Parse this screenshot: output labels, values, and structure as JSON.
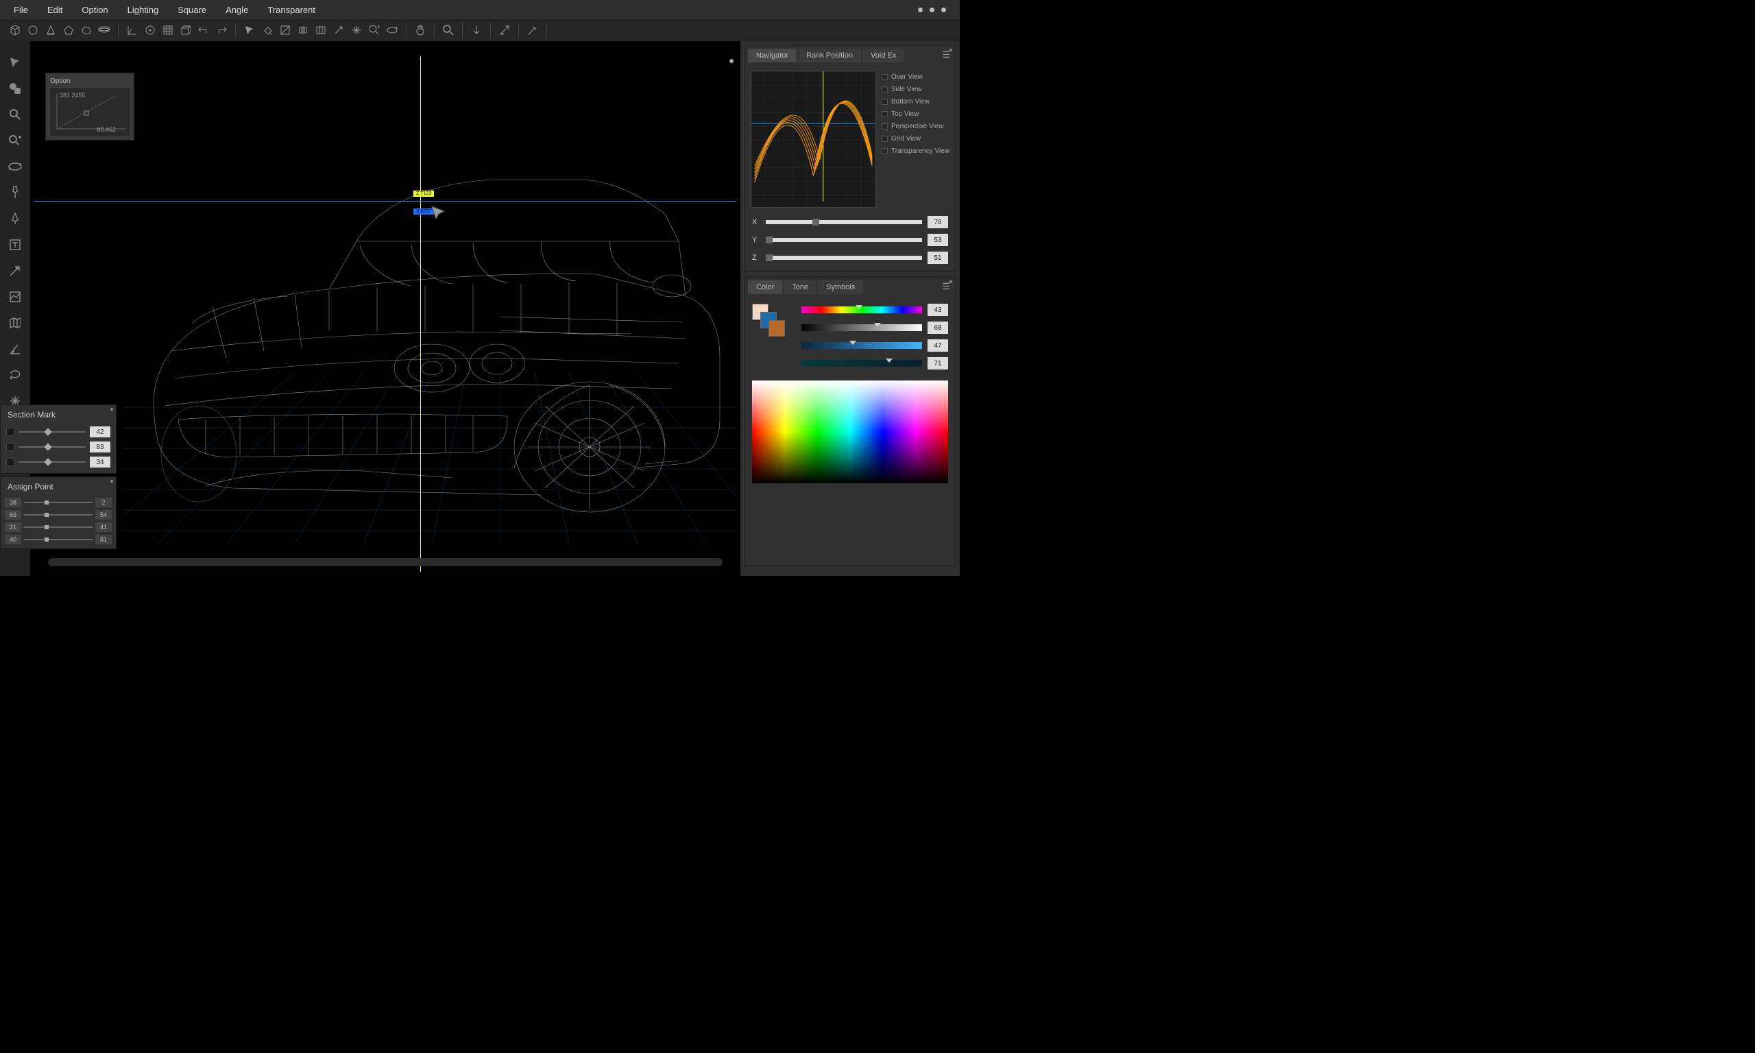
{
  "menu": {
    "items": [
      "File",
      "Edit",
      "Option",
      "Lighting",
      "Square",
      "Angle",
      "Transparent"
    ]
  },
  "option_popup": {
    "title": "Option",
    "v1": "381.2455",
    "v2": "88.462"
  },
  "viewport": {
    "marker_z": "Z T123",
    "marker_x": "X 5257"
  },
  "section_mark": {
    "title": "Section Mark",
    "rows": [
      {
        "v": "42"
      },
      {
        "v": "83"
      },
      {
        "v": "34"
      }
    ]
  },
  "assign_point": {
    "title": "Assign Point",
    "rows": [
      {
        "a": "38",
        "b": "2"
      },
      {
        "a": "69",
        "b": "54"
      },
      {
        "a": "21",
        "b": "41"
      },
      {
        "a": "40",
        "b": "81"
      }
    ]
  },
  "navigator": {
    "tabs": [
      "Navigator",
      "Rank Position",
      "Void Ex"
    ],
    "views": [
      "Over View",
      "Side View",
      "Bottom View",
      "Top View",
      "Perspective View",
      "Grid View",
      "Transparency View"
    ],
    "coords": [
      {
        "l": "X",
        "v": "76"
      },
      {
        "l": "Y",
        "v": "53"
      },
      {
        "l": "Z",
        "v": "51"
      }
    ]
  },
  "color_panel": {
    "tabs": [
      "Color",
      "Tone",
      "Symbols"
    ],
    "grads": [
      {
        "v": "43"
      },
      {
        "v": "68"
      },
      {
        "v": "47"
      },
      {
        "v": "71"
      }
    ]
  }
}
